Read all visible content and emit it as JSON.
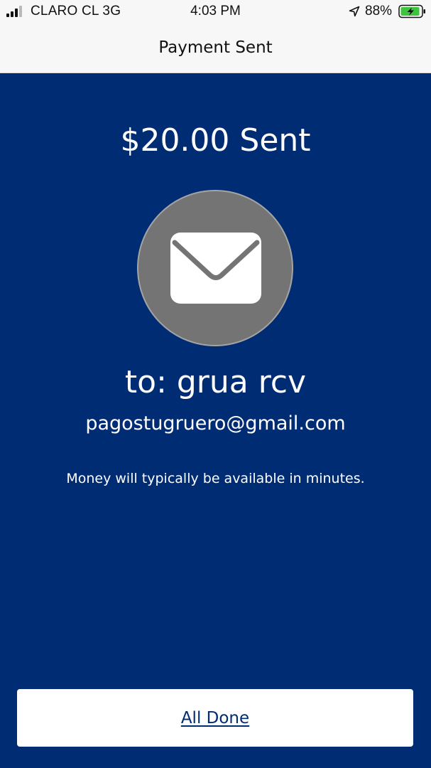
{
  "status_bar": {
    "carrier": "CLARO CL",
    "network": "3G",
    "time": "4:03 PM",
    "battery_percent": "88%",
    "signal_icon": "cellular-signal-icon",
    "location_icon": "location-arrow-icon",
    "battery_icon": "battery-charging-icon"
  },
  "nav": {
    "title": "Payment Sent"
  },
  "main": {
    "amount_title": "$20.00 Sent",
    "envelope_icon": "envelope-icon",
    "recipient_line": "to: grua rcv",
    "recipient_email": "pagostugruero@gmail.com",
    "note": "Money will typically be available in minutes."
  },
  "footer": {
    "done_label": "All Done"
  },
  "colors": {
    "background": "#002c74",
    "circle": "#747474",
    "button": "#ffffff",
    "battery_green": "#3cc43c"
  }
}
